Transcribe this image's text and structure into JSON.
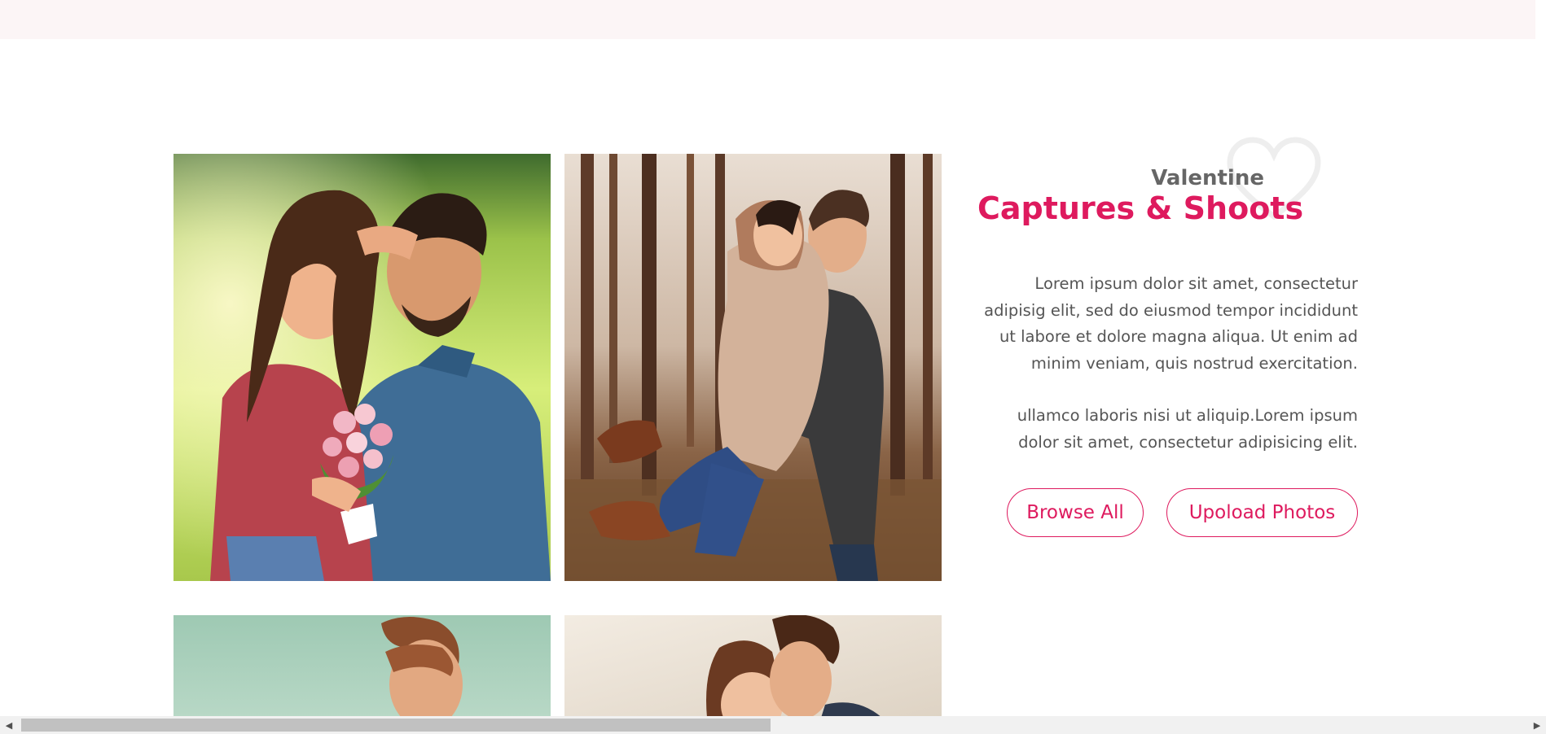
{
  "gallery": {
    "subtitle": "Valentine",
    "title": "Captures & Shoots",
    "paragraph_1": "Lorem ipsum dolor sit amet, consectetur adipisig elit, sed do eiusmod tempor incididunt ut labore et dolore magna aliqua. Ut enim ad minim veniam, quis nostrud exercitation.",
    "paragraph_2": "ullamco laboris nisi ut aliquip.Lorem ipsum dolor sit amet, consectetur adipisicing elit.",
    "buttons": {
      "browse_label": "Browse All",
      "upload_label": "Upoload Photos"
    },
    "photos": [
      "couple-with-flower-bouquet-photo",
      "couple-hugging-in-forest-photo",
      "man-profile-photo",
      "couple-kissing-photo"
    ]
  },
  "colors": {
    "accent": "#de1a5e",
    "text": "#555555",
    "top_band": "#fcf5f6"
  },
  "icons": [
    "heart-outline-icon",
    "scroll-left-arrow-icon",
    "scroll-right-arrow-icon"
  ]
}
